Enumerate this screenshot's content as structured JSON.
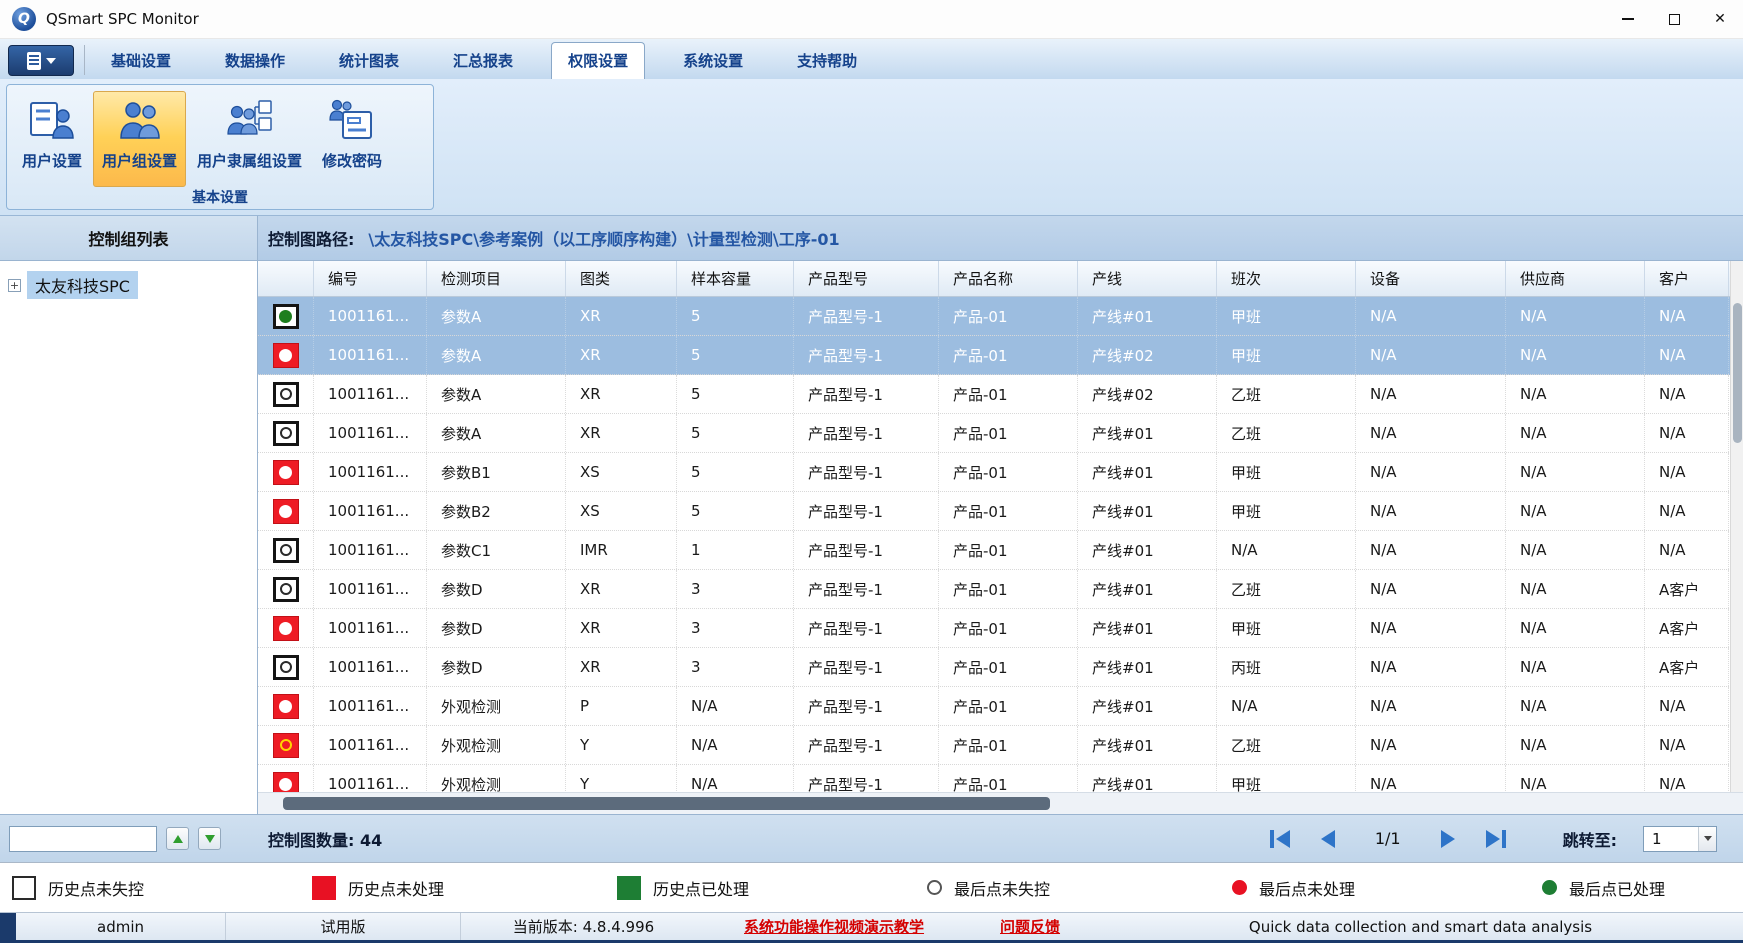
{
  "window": {
    "title": "QSmart SPC Monitor",
    "controls": {
      "minimize": "minimize",
      "maximize": "maximize",
      "close": "close"
    }
  },
  "menu": {
    "app_button": "application-menu",
    "tabs": [
      {
        "label": "基础设置",
        "active": false
      },
      {
        "label": "数据操作",
        "active": false
      },
      {
        "label": "统计图表",
        "active": false
      },
      {
        "label": "汇总报表",
        "active": false
      },
      {
        "label": "权限设置",
        "active": true
      },
      {
        "label": "系统设置",
        "active": false
      },
      {
        "label": "支持帮助",
        "active": false
      }
    ]
  },
  "ribbon": {
    "group_label": "基本设置",
    "buttons": [
      {
        "label": "用户设置",
        "icon": "user-settings-icon",
        "active": false
      },
      {
        "label": "用户组设置",
        "icon": "user-group-settings-icon",
        "active": true
      },
      {
        "label": "用户隶属组设置",
        "icon": "user-membership-settings-icon",
        "active": false
      },
      {
        "label": "修改密码",
        "icon": "change-password-icon",
        "active": false
      }
    ]
  },
  "left_panel": {
    "title": "控制组列表",
    "tree": [
      {
        "label": "太友科技SPC",
        "expander": "+",
        "selected": true
      }
    ],
    "search": {
      "value": "",
      "buttons": [
        "up",
        "down"
      ]
    }
  },
  "path_bar": {
    "label": "控制图路径:",
    "path": "\\太友科技SPC\\参考案例（以工序顺序构建）\\计量型检测\\工序-01"
  },
  "table": {
    "columns": [
      "",
      "编号",
      "检测项目",
      "图类",
      "样本容量",
      "产品型号",
      "产品名称",
      "产线",
      "班次",
      "设备",
      "供应商",
      "客户"
    ],
    "rows": [
      {
        "status": {
          "box": "white",
          "dot": "green"
        },
        "selected": true,
        "partial": false,
        "cells": [
          "1001161...",
          "参数A",
          "XR",
          "5",
          "产品型号-1",
          "产品-01",
          "产线#01",
          "甲班",
          "N/A",
          "N/A",
          "N/A"
        ]
      },
      {
        "status": {
          "box": "red",
          "dot": "white"
        },
        "selected": true,
        "partial": false,
        "cells": [
          "1001161...",
          "参数A",
          "XR",
          "5",
          "产品型号-1",
          "产品-01",
          "产线#02",
          "甲班",
          "N/A",
          "N/A",
          "N/A"
        ]
      },
      {
        "status": {
          "box": "white",
          "dot": "outline"
        },
        "selected": false,
        "partial": false,
        "cells": [
          "1001161...",
          "参数A",
          "XR",
          "5",
          "产品型号-1",
          "产品-01",
          "产线#02",
          "乙班",
          "N/A",
          "N/A",
          "N/A"
        ]
      },
      {
        "status": {
          "box": "white",
          "dot": "outline"
        },
        "selected": false,
        "partial": false,
        "cells": [
          "1001161...",
          "参数A",
          "XR",
          "5",
          "产品型号-1",
          "产品-01",
          "产线#01",
          "乙班",
          "N/A",
          "N/A",
          "N/A"
        ]
      },
      {
        "status": {
          "box": "red",
          "dot": "white"
        },
        "selected": false,
        "partial": false,
        "cells": [
          "1001161...",
          "参数B1",
          "XS",
          "5",
          "产品型号-1",
          "产品-01",
          "产线#01",
          "甲班",
          "N/A",
          "N/A",
          "N/A"
        ]
      },
      {
        "status": {
          "box": "red",
          "dot": "white"
        },
        "selected": false,
        "partial": false,
        "cells": [
          "1001161...",
          "参数B2",
          "XS",
          "5",
          "产品型号-1",
          "产品-01",
          "产线#01",
          "甲班",
          "N/A",
          "N/A",
          "N/A"
        ]
      },
      {
        "status": {
          "box": "white",
          "dot": "outline"
        },
        "selected": false,
        "partial": false,
        "cells": [
          "1001161...",
          "参数C1",
          "IMR",
          "1",
          "产品型号-1",
          "产品-01",
          "产线#01",
          "N/A",
          "N/A",
          "N/A",
          "N/A"
        ]
      },
      {
        "status": {
          "box": "white",
          "dot": "outline"
        },
        "selected": false,
        "partial": false,
        "cells": [
          "1001161...",
          "参数D",
          "XR",
          "3",
          "产品型号-1",
          "产品-01",
          "产线#01",
          "乙班",
          "N/A",
          "N/A",
          "A客户"
        ]
      },
      {
        "status": {
          "box": "red",
          "dot": "white"
        },
        "selected": false,
        "partial": false,
        "cells": [
          "1001161...",
          "参数D",
          "XR",
          "3",
          "产品型号-1",
          "产品-01",
          "产线#01",
          "甲班",
          "N/A",
          "N/A",
          "A客户"
        ]
      },
      {
        "status": {
          "box": "white",
          "dot": "outline"
        },
        "selected": false,
        "partial": false,
        "cells": [
          "1001161...",
          "参数D",
          "XR",
          "3",
          "产品型号-1",
          "产品-01",
          "产线#01",
          "丙班",
          "N/A",
          "N/A",
          "A客户"
        ]
      },
      {
        "status": {
          "box": "red",
          "dot": "white"
        },
        "selected": false,
        "partial": false,
        "cells": [
          "1001161...",
          "外观检测",
          "P",
          "N/A",
          "产品型号-1",
          "产品-01",
          "产线#01",
          "N/A",
          "N/A",
          "N/A",
          "N/A"
        ]
      },
      {
        "status": {
          "box": "red",
          "dot": "yellow-outline"
        },
        "selected": false,
        "partial": false,
        "cells": [
          "1001161...",
          "外观检测",
          "Y",
          "N/A",
          "产品型号-1",
          "产品-01",
          "产线#01",
          "乙班",
          "N/A",
          "N/A",
          "N/A"
        ]
      },
      {
        "status": {
          "box": "red",
          "dot": "white"
        },
        "selected": false,
        "partial": true,
        "cells": [
          "1001161...",
          "外观检测",
          "Y",
          "N/A",
          "产品型号-1",
          "产品-01",
          "产线#01",
          "甲班",
          "N/A",
          "N/A",
          "N/A"
        ]
      }
    ]
  },
  "pagination": {
    "count_label": "控制图数量: 44",
    "page": "1/1",
    "jump_label": "跳转至:",
    "jump_value": "1"
  },
  "legend": {
    "items": [
      {
        "shape": "square",
        "color": "white",
        "label": "历史点未失控"
      },
      {
        "shape": "square",
        "color": "red",
        "label": "历史点未处理"
      },
      {
        "shape": "square",
        "color": "green",
        "label": "历史点已处理"
      },
      {
        "shape": "circle",
        "color": "white",
        "label": "最后点未失控"
      },
      {
        "shape": "circle",
        "color": "red",
        "label": "最后点未处理"
      },
      {
        "shape": "circle",
        "color": "green",
        "label": "最后点已处理"
      }
    ]
  },
  "status_bar": {
    "user": "admin",
    "license": "试用版",
    "version": "当前版本: 4.8.4.996",
    "video_link": "系统功能操作视频演示教学",
    "feedback_link": "问题反馈",
    "slogan": "Quick data collection and smart data analysis"
  },
  "colors": {
    "selection_blue": "#9cbde0",
    "ribbon_highlight_orange": "#ffd157",
    "status_red": "#ee1c25",
    "status_green": "#1e7e1e",
    "link_red": "#d40000",
    "tab_text_blue": "#15428b"
  }
}
